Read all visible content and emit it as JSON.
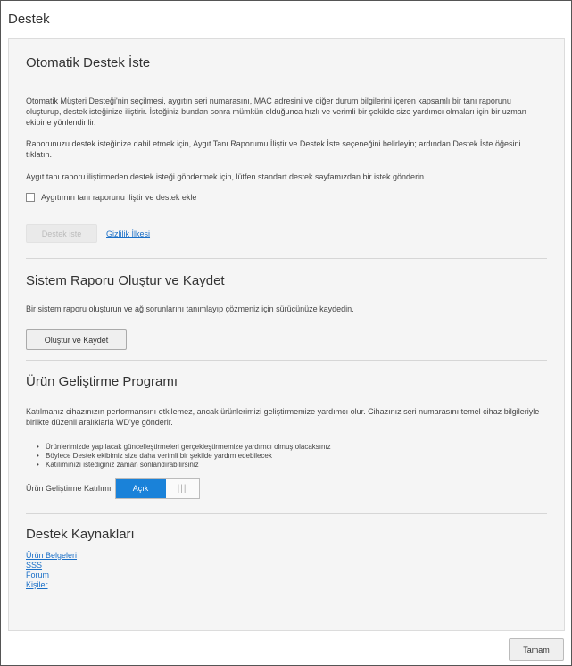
{
  "dialog": {
    "title": "Destek"
  },
  "auto_support": {
    "heading": "Otomatik Destek İste",
    "para1": "Otomatik Müşteri Desteği'nin seçilmesi, aygıtın seri numarasını, MAC adresini ve diğer durum bilgilerini içeren kapsamlı bir tanı raporunu oluşturup, destek isteğinize iliştirir. İsteğiniz bundan sonra mümkün olduğunca hızlı ve verimli bir şekilde size yardımcı olmaları için bir uzman ekibine yönlendirilir.",
    "para2": "Raporunuzu destek isteğinize dahil etmek için, Aygıt Tanı Raporumu İliştir ve Destek İste seçeneğini belirleyin; ardından Destek İste öğesini tıklatın.",
    "para3": "Aygıt tanı raporu iliştirmeden destek isteği göndermek için, lütfen standart destek sayfamızdan bir istek gönderin.",
    "checkbox_label": "Aygıtımın tanı raporunu iliştir ve destek ekle",
    "checkbox_checked": false,
    "request_button": "Destek iste",
    "privacy_link": "Gizlilik İlkesi"
  },
  "system_report": {
    "heading": "Sistem Raporu Oluştur ve Kaydet",
    "para": "Bir sistem raporu oluşturun ve ağ sorunlarını tanımlayıp çözmeniz için sürücünüze kaydedin.",
    "button": "Oluştur ve Kaydet"
  },
  "improvement": {
    "heading": "Ürün Geliştirme Programı",
    "para": "Katılmanız cihazınızın performansını etkilemez, ancak ürünlerimizi geliştirmemize yardımcı olur. Cihazınız seri numarasını temel cihaz bilgileriyle birlikte düzenli aralıklarla WD'ye gönderir.",
    "bullets": [
      "Ürünlerimizde yapılacak güncelleştirmeleri gerçekleştirmemize yardımcı olmuş olacaksınız",
      "Böylece Destek ekibimiz size daha verimli bir şekilde yardım edebilecek",
      "Katılımınızı istediğiniz zaman sonlandırabilirsiniz"
    ],
    "toggle_label": "Ürün Geliştirme Katılımı",
    "toggle_on": "Açık",
    "toggle_off": "|||",
    "toggle_state": "on"
  },
  "resources": {
    "heading": "Destek Kaynakları",
    "links": [
      "Ürün Belgeleri",
      "SSS",
      "Forum",
      "Kişiler"
    ]
  },
  "footer": {
    "ok_button": "Tamam"
  },
  "colors": {
    "accent": "#1a82d9",
    "link": "#1a6fc7",
    "panel": "#f5f5f5"
  }
}
